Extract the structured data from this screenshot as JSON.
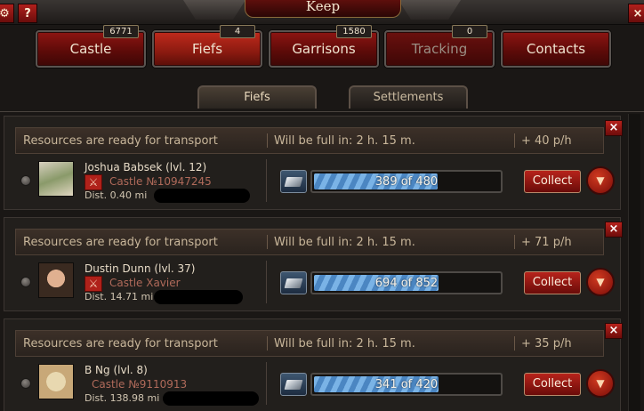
{
  "window": {
    "title": "Keep",
    "help_label": "?",
    "close_label": "×"
  },
  "nav": [
    {
      "label": "Castle",
      "badge": "6771"
    },
    {
      "label": "Fiefs",
      "badge": "4"
    },
    {
      "label": "Garrisons",
      "badge": "1580"
    },
    {
      "label": "Tracking",
      "badge": "0"
    },
    {
      "label": "Contacts",
      "badge": ""
    }
  ],
  "subtabs": [
    "Fiefs",
    "Settlements"
  ],
  "fiefs": [
    {
      "status": "Resources are ready for transport",
      "full_in": "Will be full in: 2 h. 15 m.",
      "rate": "+ 40 p/h",
      "name": "Joshua Babsek (lvl. 12)",
      "castle": "Castle №10947245",
      "dist": "Dist. 0.40 mi",
      "resource_icon": "silver-icon",
      "progress": "389 of 480",
      "progress_value": 389,
      "progress_max": 480,
      "collect_label": "Collect"
    },
    {
      "status": "Resources are ready for transport",
      "full_in": "Will be full in: 2 h. 15 m.",
      "rate": "+ 71 p/h",
      "name": "Dustin Dunn (lvl. 37)",
      "castle": "Castle Xavier",
      "dist": "Dist. 14.71 mi",
      "resource_icon": "silver-icon",
      "progress": "694 of 852",
      "progress_value": 694,
      "progress_max": 852,
      "collect_label": "Collect"
    },
    {
      "status": "Resources are ready for transport",
      "full_in": "Will be full in: 2 h. 15 m.",
      "rate": "+ 35 p/h",
      "name": "B Ng (lvl. 8)",
      "castle": "Castle №9110913",
      "dist": "Dist. 138.98 mi",
      "resource_icon": "silver-icon",
      "progress": "341 of 420",
      "progress_value": 341,
      "progress_max": 420,
      "collect_label": "Collect"
    }
  ],
  "colors": {
    "accent_red": "#b0211a",
    "bar_blue": "#7ab3e6",
    "panel": "#221f1c"
  }
}
